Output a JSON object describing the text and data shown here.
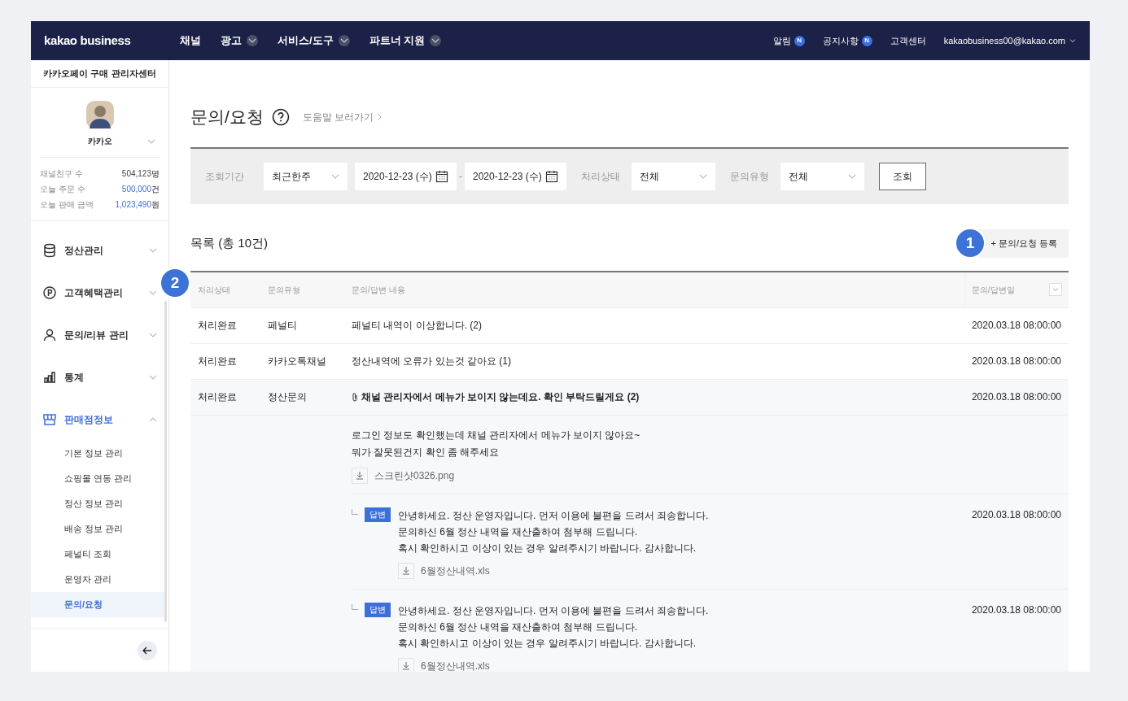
{
  "header": {
    "logo": "kakao business",
    "nav": [
      {
        "label": "채널",
        "dropdown": false
      },
      {
        "label": "광고",
        "dropdown": true
      },
      {
        "label": "서비스/도구",
        "dropdown": true
      },
      {
        "label": "파트너 지원",
        "dropdown": true
      }
    ],
    "links": [
      {
        "label": "알림",
        "badge": "N"
      },
      {
        "label": "공지사항",
        "badge": "N"
      },
      {
        "label": "고객센터"
      }
    ],
    "account": "kakaobusiness00@kakao.com"
  },
  "sidebar": {
    "title": "카카오페이 구매 관리자센터",
    "profile": {
      "name": "카카오"
    },
    "stats": [
      {
        "label": "채널친구 수",
        "value": "504,123",
        "unit": "명",
        "highlight": false
      },
      {
        "label": "오늘 주문 수",
        "value": "500,000",
        "unit": "건",
        "highlight": true
      },
      {
        "label": "오늘 판매 금액",
        "value": "1,023,490",
        "unit": "원",
        "highlight": true
      }
    ],
    "menu": [
      {
        "label": "정산관리",
        "kind": "database",
        "expanded": false
      },
      {
        "label": "고객혜택관리",
        "kind": "point",
        "expanded": false
      },
      {
        "label": "문의/리뷰 관리",
        "kind": "person",
        "expanded": false
      },
      {
        "label": "통계",
        "kind": "chart",
        "expanded": false
      },
      {
        "label": "판매점정보",
        "kind": "store",
        "expanded": true,
        "children": [
          {
            "label": "기본 정보 관리",
            "selected": false
          },
          {
            "label": "쇼핑몰 연동 관리",
            "selected": false
          },
          {
            "label": "정산 정보 관리",
            "selected": false
          },
          {
            "label": "배송 정보 관리",
            "selected": false
          },
          {
            "label": "페널티 조회",
            "selected": false
          },
          {
            "label": "운영자 관리",
            "selected": false
          },
          {
            "label": "문의/요청",
            "selected": true
          }
        ]
      }
    ]
  },
  "page": {
    "title": "문의/요청",
    "help_link": "도움말 보러가기"
  },
  "filter": {
    "period_label": "조회기간",
    "period": "최근한주",
    "start": "2020-12-23 (수)",
    "separator": "-",
    "end": "2020-12-23 (수)",
    "status_label": "처리상태",
    "status": "전체",
    "type_label": "문의유형",
    "type": "전체",
    "search_button": "조회"
  },
  "list": {
    "title": "목록 (총 10건)",
    "register_button": "+ 문의/요청 등록",
    "columns": [
      "처리상태",
      "문의유형",
      "문의/답변 내용",
      "문의/답변일"
    ],
    "rows": [
      {
        "status": "처리완료",
        "type": "페널티",
        "content": "페널티 내역이 이상합니다. (2)",
        "date": "2020.03.18 08:00:00",
        "attachment": false,
        "expanded": false
      },
      {
        "status": "처리완료",
        "type": "카카오톡채널",
        "content": "정산내역에 오류가 있는것 같아요 (1)",
        "date": "2020.03.18 08:00:00",
        "attachment": false,
        "expanded": false
      },
      {
        "status": "처리완료",
        "type": "정산문의",
        "content": "채널 관리자에서 메뉴가 보이지 않는데요. 확인 부탁드릴게요 (2)",
        "date": "2020.03.18 08:00:00",
        "attachment": true,
        "expanded": true,
        "detail": {
          "lines": [
            "로그인 정보도 확인했는데 채널 관리자에서 메뉴가 보이지 않아요~",
            "뭐가 잘못된건지 확인 좀 해주세요"
          ],
          "file": "스크린샷0326.png",
          "answers": [
            {
              "badge": "답변",
              "lines": [
                "안녕하세요. 정산 운영자입니다. 먼저 이용에 불편을 드려서 죄송합니다.",
                "문의하신 6월 정산 내역을 재산출하여 첨부해 드립니다.",
                "혹시 확인하시고 이상이 있는 경우 알려주시기 바랍니다. 감사합니다."
              ],
              "file": "6월정산내역.xls",
              "date": "2020.03.18 08:00:00"
            },
            {
              "badge": "답변",
              "lines": [
                "안녕하세요. 정산 운영자입니다. 먼저 이용에 불편을 드려서 죄송합니다.",
                "문의하신 6월 정산 내역을 재산출하여 첨부해 드립니다.",
                "혹시 확인하시고 이상이 있는 경우 알려주시기 바랍니다. 감사합니다."
              ],
              "file": "6월정산내역.xls",
              "date": "2020.03.18 08:00:00"
            }
          ]
        }
      }
    ]
  },
  "annotations": [
    "1",
    "2"
  ]
}
